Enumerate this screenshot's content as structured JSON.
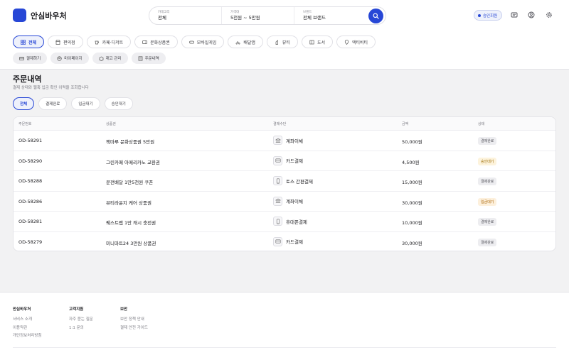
{
  "app": {
    "name": "안심바우처"
  },
  "search": {
    "category_label": "카테고리",
    "category_value": "전체",
    "price_label": "가격대",
    "price_value": "5천원 ~ 5만원",
    "brand_label": "브랜드",
    "brand_value": "전체 브랜드"
  },
  "header": {
    "auth_badge": "승인회원"
  },
  "categories": [
    "전체",
    "편의점",
    "카페·디저트",
    "문화상품권",
    "모바일게임",
    "배달앱",
    "뷰티",
    "도서",
    "액티비티"
  ],
  "quick_links": [
    "결제하기",
    "마이페이지",
    "재고 관리",
    "주문내역"
  ],
  "page": {
    "title": "주문내역",
    "subtitle": "결제 상태와 웹훅 입금 확인 이력을 조회합니다"
  },
  "filter_tabs": [
    "전체",
    "결제완료",
    "입금대기",
    "승인대기"
  ],
  "table": {
    "columns": [
      "주문번호",
      "상품권",
      "결제수단",
      "금액",
      "상태"
    ],
    "rows": [
      {
        "id": "OD-58291",
        "product": "책마루 문화상품권 5만원",
        "method": "계좌이체",
        "method_icon": "bank-icon",
        "amount": "50,000원",
        "status": "결제완료",
        "status_type": "done"
      },
      {
        "id": "OD-58290",
        "product": "그린카페 아메리카노 교환권",
        "method": "카드결제",
        "method_icon": "card-icon",
        "amount": "4,500원",
        "status": "승인대기",
        "status_type": "approval"
      },
      {
        "id": "OD-58288",
        "product": "문전배달 1만5천원 쿠폰",
        "method": "토스 간편결제",
        "method_icon": "phone-icon",
        "amount": "15,000원",
        "status": "결제완료",
        "status_type": "done"
      },
      {
        "id": "OD-58286",
        "product": "뷰티라운지 케어 상품권",
        "method": "계좌이체",
        "method_icon": "bank-icon",
        "amount": "30,000원",
        "status": "입금대기",
        "status_type": "deposit"
      },
      {
        "id": "OD-58281",
        "product": "퀘스트랩 1만 캐시 충전권",
        "method": "휴대폰결제",
        "method_icon": "phone-icon",
        "amount": "10,000원",
        "status": "결제완료",
        "status_type": "done"
      },
      {
        "id": "OD-58279",
        "product": "미니마트24 3만원 상품권",
        "method": "카드결제",
        "method_icon": "card-icon",
        "amount": "30,000원",
        "status": "결제완료",
        "status_type": "done"
      }
    ]
  },
  "footer": {
    "col1": {
      "title": "안심바우처",
      "links": [
        "서비스 소개",
        "이용약관",
        "개인정보처리방침"
      ]
    },
    "col2": {
      "title": "고객지원",
      "links": [
        "자주 묻는 질문",
        "1:1 문의"
      ]
    },
    "col3": {
      "title": "보안",
      "links": [
        "보안 정책 안내",
        "결제 안전 가이드"
      ]
    }
  },
  "colors": {
    "accent": "#2747d6",
    "done_bg": "#ededf0",
    "done_fg": "#55555c",
    "approval_bg": "#fdf3dc",
    "approval_fg": "#9a6a00",
    "deposit_bg": "#fdf0dc",
    "deposit_fg": "#a86200"
  }
}
